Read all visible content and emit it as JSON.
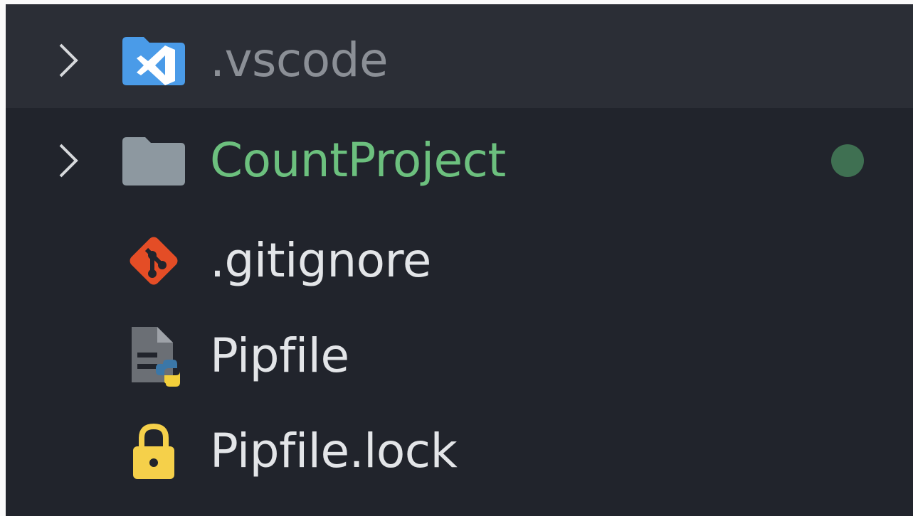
{
  "explorer": {
    "items": [
      {
        "label": ".vscode",
        "type": "folder",
        "expanded": false,
        "icon": "vscode-folder-icon"
      },
      {
        "label": "CountProject",
        "type": "folder",
        "expanded": false,
        "icon": "folder-icon",
        "git_status_color": "#3f7052",
        "label_color": "#6cc07e"
      },
      {
        "label": ".gitignore",
        "type": "file",
        "icon": "git-icon"
      },
      {
        "label": "Pipfile",
        "type": "file",
        "icon": "python-file-icon"
      },
      {
        "label": "Pipfile.lock",
        "type": "file",
        "icon": "lock-icon"
      }
    ]
  }
}
